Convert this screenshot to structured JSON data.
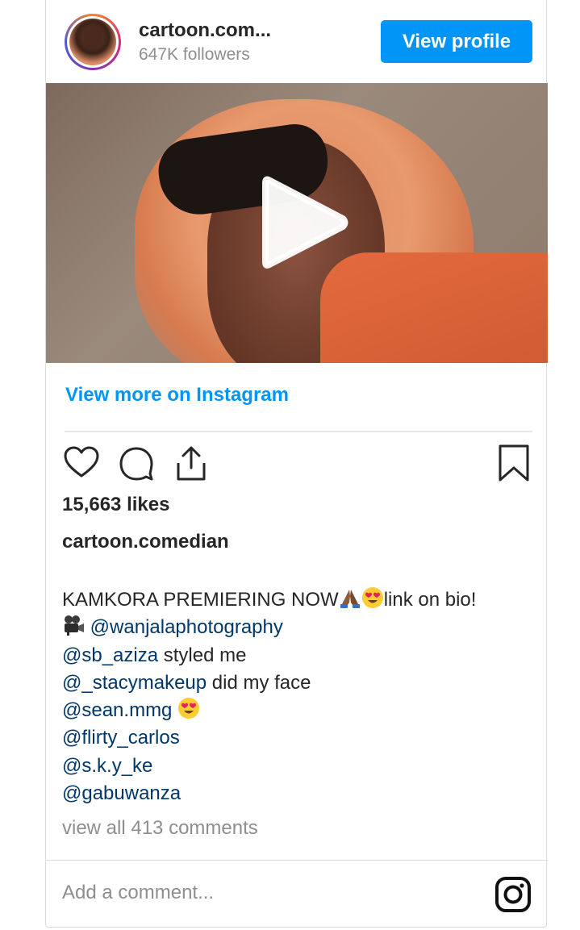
{
  "header": {
    "username": "cartoon.com...",
    "followers": "647K followers",
    "view_profile_label": "View profile"
  },
  "media": {
    "play_icon": "play-icon"
  },
  "view_more_label": "View more on Instagram",
  "actions": {
    "icons": [
      "heart-icon",
      "comment-icon",
      "share-icon",
      "bookmark-icon"
    ]
  },
  "post": {
    "likes": "15,663 likes",
    "caption_username": "cartoon.comedian",
    "caption": {
      "l1_text": "KAMKORA PREMIERING NOW",
      "l1_text_end": "link on bio!",
      "l2_mention": "@wanjalaphotography",
      "l3_mention": "@sb_aziza",
      "l3_text": " styled me",
      "l4_mention": "@_stacymakeup",
      "l4_text": " did my face",
      "l5_mention": "@sean.mmg",
      "l6_mention": "@flirty_carlos",
      "l7_mention": "@s.k.y_ke",
      "l8_mention": "@gabuwanza"
    },
    "view_comments": "view all 413 comments",
    "add_comment_placeholder": "Add a comment..."
  },
  "colors": {
    "link_blue": "#0095f6",
    "mention_blue": "#00376b",
    "text": "#262626",
    "muted": "#8e8e8e"
  }
}
